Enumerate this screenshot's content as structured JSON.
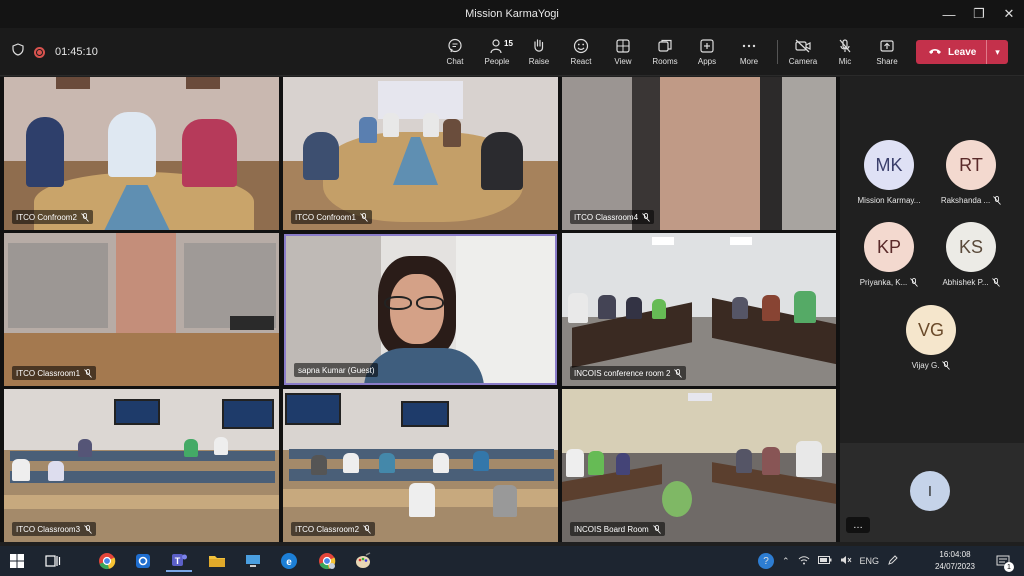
{
  "window": {
    "title": "Mission KarmaYogi"
  },
  "toolbar": {
    "timer": "01:45:10",
    "people_count": "15",
    "buttons": [
      {
        "label": "Chat",
        "icon": "chat-icon"
      },
      {
        "label": "People",
        "icon": "people-icon"
      },
      {
        "label": "Raise",
        "icon": "raise-hand-icon"
      },
      {
        "label": "React",
        "icon": "react-icon"
      },
      {
        "label": "View",
        "icon": "view-icon"
      },
      {
        "label": "Rooms",
        "icon": "rooms-icon"
      },
      {
        "label": "Apps",
        "icon": "apps-icon"
      },
      {
        "label": "More",
        "icon": "more-icon"
      },
      {
        "label": "Camera",
        "icon": "camera-off-icon"
      },
      {
        "label": "Mic",
        "icon": "mic-off-icon"
      },
      {
        "label": "Share",
        "icon": "share-icon"
      }
    ],
    "leave_label": "Leave"
  },
  "tiles": [
    {
      "name": "ITCO Confroom2"
    },
    {
      "name": "ITCO Confroom1"
    },
    {
      "name": "ITCO Classroom4"
    },
    {
      "name": "ITCO Classroom1"
    },
    {
      "name": "sapna Kumar (Guest)"
    },
    {
      "name": "INCOIS conference room 2"
    },
    {
      "name": "ITCO Classroom3"
    },
    {
      "name": "ITCO Classroom2"
    },
    {
      "name": "INCOIS Board Room"
    }
  ],
  "participants": [
    {
      "initials": "MK",
      "name": "Mission Karmay..."
    },
    {
      "initials": "RT",
      "name": "Rakshanda ..."
    },
    {
      "initials": "KP",
      "name": "Priyanka, K..."
    },
    {
      "initials": "KS",
      "name": "Abhishek P..."
    },
    {
      "initials": "VG",
      "name": "Vijay G."
    }
  ],
  "self": {
    "initials": "I"
  },
  "colors": {
    "leave": "#c4314b",
    "avatar_bg": "#f3d9cf",
    "highlight": "#8a7cc9"
  },
  "taskbar": {
    "lang": "ENG",
    "time": "16:04:08",
    "date": "24/07/2023",
    "notification_count": "1"
  }
}
